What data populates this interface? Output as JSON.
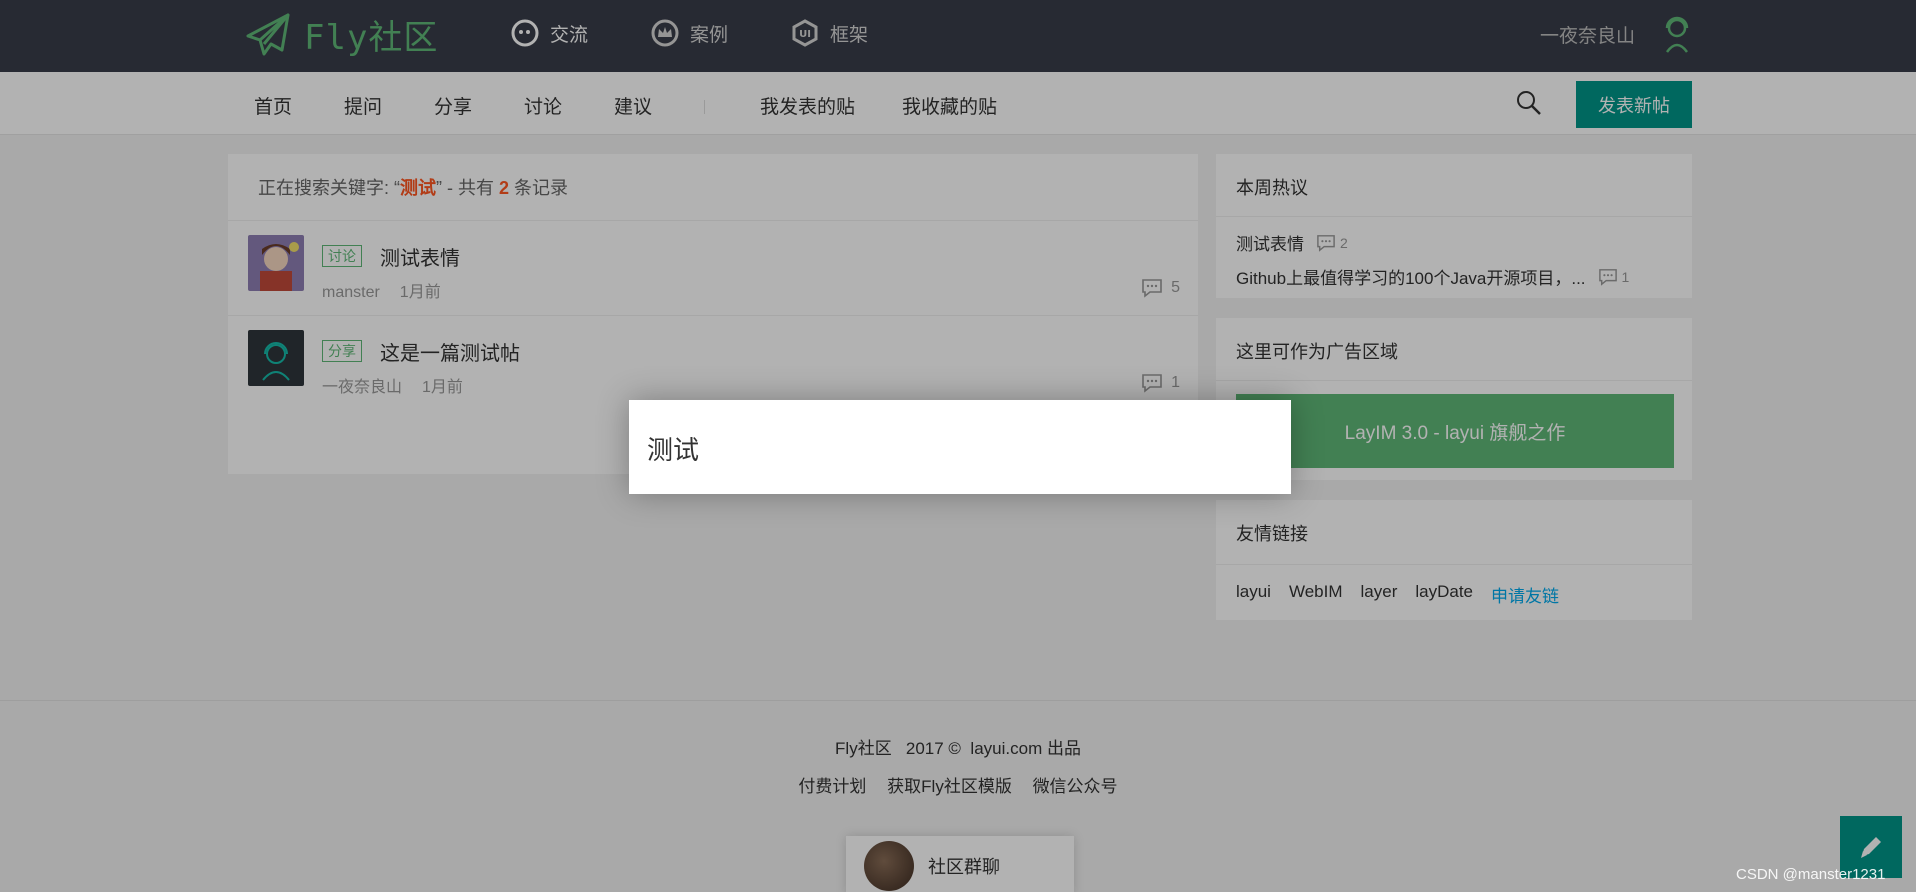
{
  "header": {
    "logo_text": "Fly社区",
    "nav": [
      {
        "label": "交流",
        "icon": "chat-bubble-icon"
      },
      {
        "label": "案例",
        "icon": "crown-icon"
      },
      {
        "label": "框架",
        "icon": "ui-icon"
      }
    ],
    "username": "一夜奈良山"
  },
  "subnav": {
    "items": [
      "首页",
      "提问",
      "分享",
      "讨论",
      "建议"
    ],
    "mine": [
      "我发表的贴",
      "我收藏的贴"
    ],
    "post_button": "发表新帖"
  },
  "search": {
    "prefix": "正在搜索关键字: “",
    "keyword": "测试",
    "middle": "” - 共有",
    "count": "2",
    "suffix": "条记录"
  },
  "posts": [
    {
      "badge": "讨论",
      "title": "测试表情",
      "author": "manster",
      "time": "1月前",
      "comments": "5"
    },
    {
      "badge": "分享",
      "title": "这是一篇测试帖",
      "author": "一夜奈良山",
      "time": "1月前",
      "comments": "1"
    }
  ],
  "sidebar": {
    "hot_title": "本周热议",
    "hot_items": [
      {
        "title": "测试表情",
        "count": "2"
      },
      {
        "title": "Github上最值得学习的100个Java开源项目，...",
        "count": "1"
      }
    ],
    "ad_title": "这里可作为广告区域",
    "ad_banner": "LayIM 3.0 - layui 旗舰之作",
    "links_title": "友情链接",
    "links": [
      "layui",
      "WebIM",
      "layer",
      "layDate"
    ],
    "apply_link": "申请友链"
  },
  "footer": {
    "line1_brand": "Fly社区",
    "line1_year": "2017 ©",
    "line1_site": "layui.com 出品",
    "links": [
      "付费计划",
      "获取Fly社区模版",
      "微信公众号"
    ]
  },
  "chat": {
    "label": "社区群聊"
  },
  "dialog": {
    "input_value": "测试"
  },
  "watermark": "CSDN @manster1231",
  "colors": {
    "header_bg": "#393d49",
    "accent": "#009688",
    "green": "#5fb878",
    "highlight": "#ff5722"
  }
}
